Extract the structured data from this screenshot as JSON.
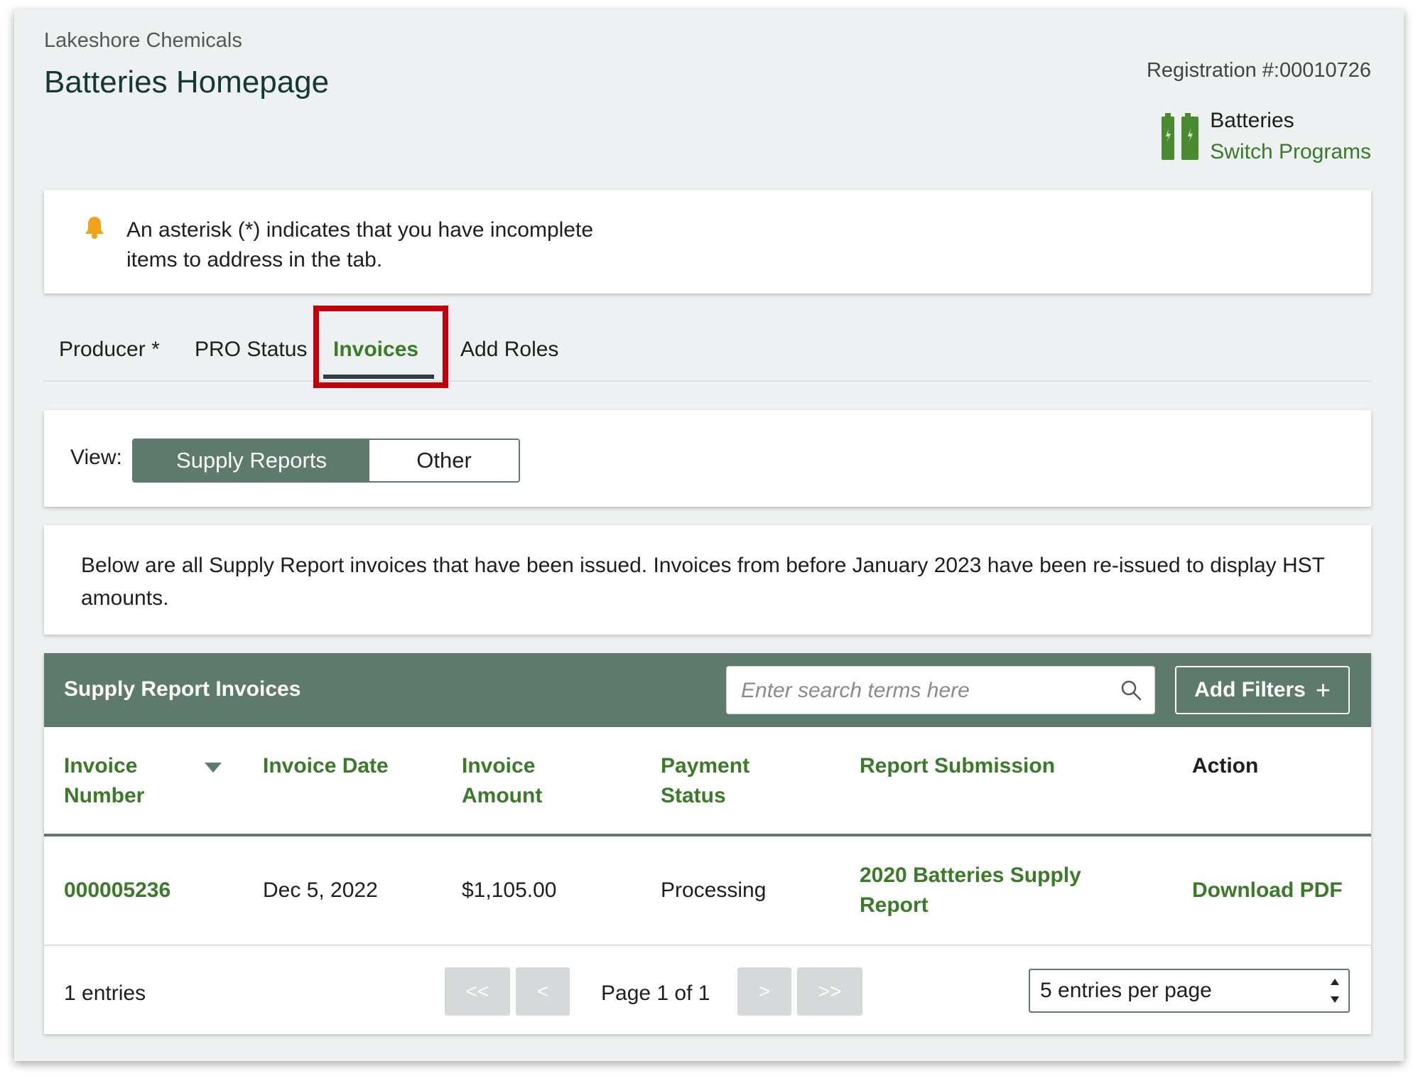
{
  "header": {
    "company": "Lakeshore Chemicals",
    "title": "Batteries Homepage",
    "registration": "Registration #:00010726"
  },
  "program": {
    "name": "Batteries",
    "switch_label": "Switch Programs",
    "icon": "battery-icon",
    "icon_color": "#4a8a30"
  },
  "notice": {
    "icon": "bell-icon",
    "icon_color": "#f0a21a",
    "text": "An asterisk (*) indicates that you have incomplete items to address in the tab."
  },
  "tabs": [
    {
      "label": "Producer *"
    },
    {
      "label": "PRO Status"
    },
    {
      "label": "Invoices",
      "active": true
    },
    {
      "label": "Add Roles"
    }
  ],
  "view": {
    "label": "View:",
    "options": [
      "Supply Reports",
      "Other"
    ],
    "selected": "Supply Reports"
  },
  "description": "Below are all Supply Report invoices that have been issued. Invoices from before January 2023 have been re-issued to display HST amounts.",
  "table": {
    "title": "Supply Report Invoices",
    "search_placeholder": "Enter search terms here",
    "add_filters_label": "Add Filters",
    "add_filters_icon": "+",
    "columns": [
      "Invoice Number",
      "Invoice Date",
      "Invoice Amount",
      "Payment Status",
      "Report Submission",
      "Action"
    ],
    "rows": [
      {
        "invoice_number": "000005236",
        "invoice_date": "Dec 5, 2022",
        "invoice_amount": "$1,105.00",
        "payment_status": "Processing",
        "report_submission": "2020 Batteries Supply Report",
        "action": "Download PDF"
      }
    ],
    "entries": "1 entries",
    "pagination": {
      "first": "<<",
      "prev": "<",
      "page_info": "Page 1 of 1",
      "next": ">",
      "last": ">>"
    },
    "per_page": "5 entries per page"
  },
  "colors": {
    "brand_green": "#3a7a28",
    "header_bar": "#5e7a6d",
    "highlight_red": "#c0000c",
    "background": "#eef1f1"
  }
}
